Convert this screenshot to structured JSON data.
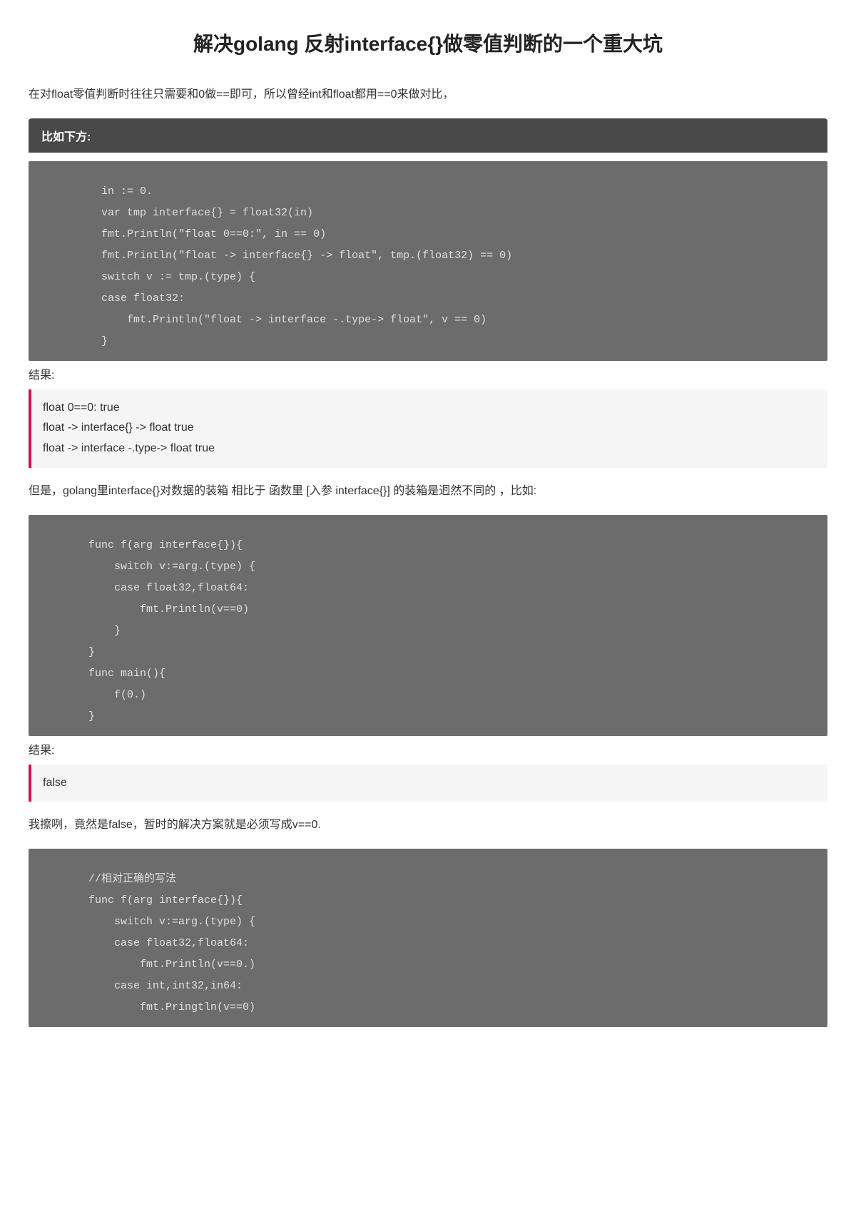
{
  "title": "解决golang 反射interface{}做零值判断的一个重大坑",
  "intro": "在对float零值判断时往往只需要和0做==即可，所以曾经int和float都用==0来做对比，",
  "section1": {
    "header": "比如下方:",
    "code": "          in := 0.\n          var tmp interface{} = float32(in)\n          fmt.Println(\"float 0==0:\", in == 0)\n          fmt.Println(\"float -> interface{} -> float\", tmp.(float32) == 0)\n          switch v := tmp.(type) {\n          case float32:\n              fmt.Println(\"float -> interface -.type-> float\", v == 0)\n          }"
  },
  "result_label": "结果:",
  "result1": "float 0==0: true\nfloat -> interface{} -> float true\nfloat -> interface -.type-> float true",
  "para2": "但是，golang里interface{}对数据的装箱 相比于 函数里 [入参 interface{}] 的装箱是迥然不同的 ，比如:",
  "code2": "        func f(arg interface{}){\n            switch v:=arg.(type) {\n            case float32,float64:\n                fmt.Println(v==0)\n            }\n        }\n        func main(){\n            f(0.)\n        }",
  "result2": "false",
  "para3": "我擦咧，竟然是false，暂时的解决方案就是必须写成v==0.",
  "code3": "        //相对正确的写法\n        func f(arg interface{}){\n            switch v:=arg.(type) {\n            case float32,float64:\n                fmt.Println(v==0.)\n            case int,int32,in64:\n                fmt.Pringtln(v==0)"
}
